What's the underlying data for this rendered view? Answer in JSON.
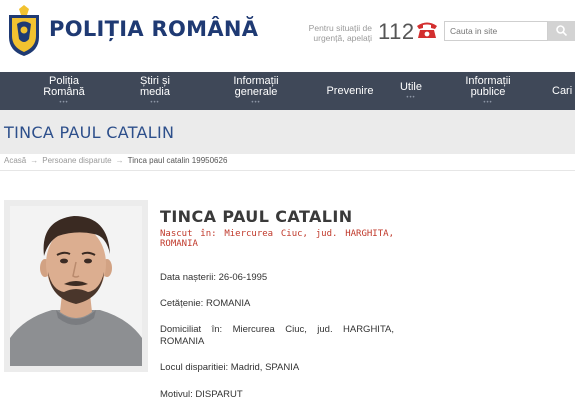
{
  "header": {
    "site_title": "POLIȚIA ROMÂNĂ",
    "emergency_note": "Pentru situații de urgență, apelați",
    "emergency_number": "112",
    "search_placeholder": "Cauta in site",
    "icons": [
      "coat-of-arms-logo",
      "phone-icon",
      "search-icon"
    ],
    "colors": {
      "brand": "#1f3a73",
      "phone": "#d32f2f",
      "nav_bg": "#3f4858"
    }
  },
  "nav": {
    "items": [
      {
        "label": "Poliția\nRomână"
      },
      {
        "label": "Știri și\nmedia"
      },
      {
        "label": "Informații\ngenerale"
      },
      {
        "label": "Prevenire"
      },
      {
        "label": "Utile"
      },
      {
        "label": "Informații\npublice"
      },
      {
        "label": "Cari"
      }
    ]
  },
  "page": {
    "title": "TINCA PAUL CATALIN"
  },
  "breadcrumb": {
    "items": [
      "Acasă",
      "Persoane disparute",
      "Tinca paul catalin 19950626"
    ]
  },
  "person": {
    "name": "TINCA PAUL CATALIN",
    "birth_place_note": "Nascut în: Miercurea Ciuc, jud. HARGHITA, ROMANIA",
    "fields": [
      {
        "label": "Data nașterii:",
        "value": "26-06-1995"
      },
      {
        "label": "Cetățenie:",
        "value": "ROMANIA"
      },
      {
        "label": "Domiciliat în:",
        "value": "Miercurea Ciuc, jud. HARGHITA, ROMANIA"
      },
      {
        "label": "Locul disparitiei:",
        "value": "Madrid, SPANIA"
      },
      {
        "label": "Motivul:",
        "value": "DISPARUT"
      }
    ]
  }
}
